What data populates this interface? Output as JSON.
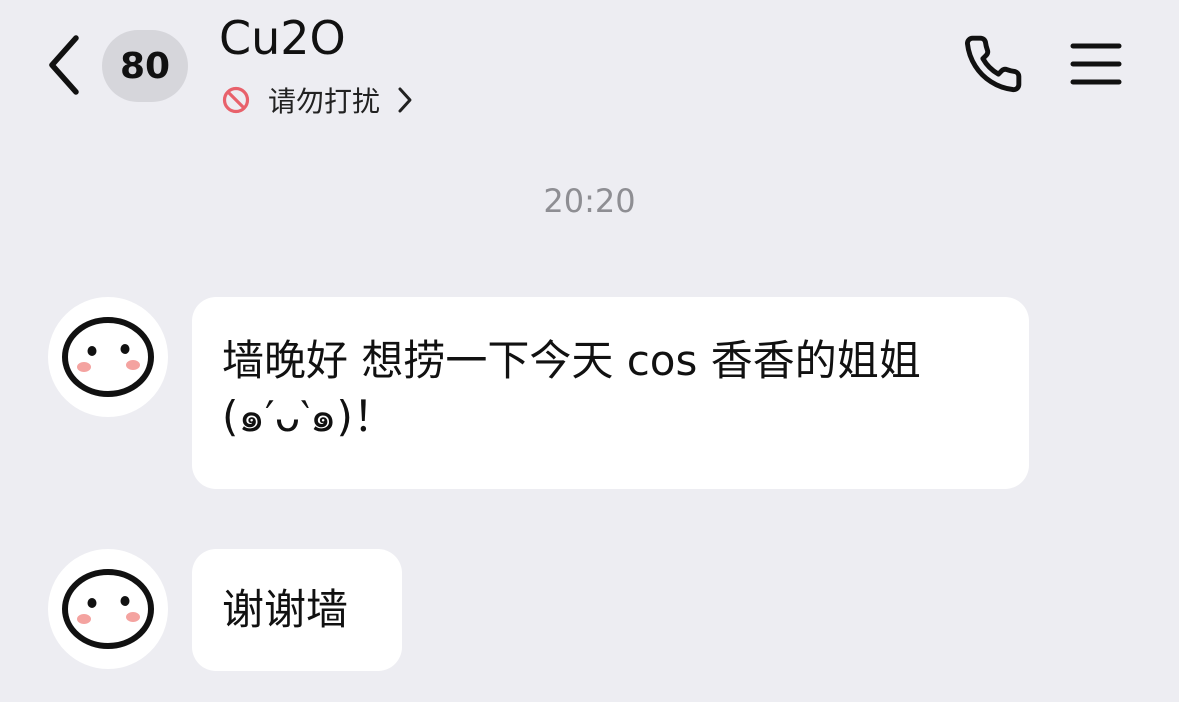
{
  "header": {
    "back_icon": "chevron-left-icon",
    "unread_count": "80",
    "contact_name": "Cu2O",
    "status_icon": "do-not-disturb-icon",
    "status_text": "请勿打扰",
    "status_chevron_icon": "chevron-right-icon",
    "call_icon": "phone-icon",
    "menu_icon": "hamburger-menu-icon"
  },
  "chat": {
    "timestamp": "20:20",
    "messages": [
      {
        "sender": "Cu2O",
        "avatar_icon": "face-avatar-icon",
        "text": "墙晚好 想捞一下今天 cos 香香的姐姐 (๑′ᴗ‵๑)！"
      },
      {
        "sender": "Cu2O",
        "avatar_icon": "face-avatar-icon",
        "text": "谢谢墙"
      }
    ]
  },
  "colors": {
    "background": "#ededf2",
    "bubble": "#ffffff",
    "badge": "#d6d6db",
    "timestamp": "#8e8e93",
    "dnd_red": "#e8616b",
    "cheek_pink": "#f4a3a0"
  }
}
